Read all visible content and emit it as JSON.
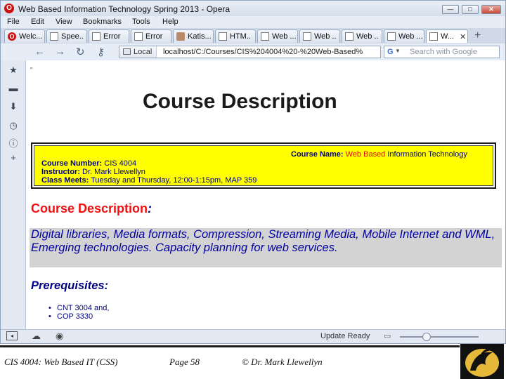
{
  "browser": {
    "title": "Web Based Information Technology Spring 2013 - Opera",
    "window_buttons": {
      "min": "—",
      "max": "□",
      "close": "✕"
    },
    "menu": [
      "File",
      "Edit",
      "View",
      "Bookmarks",
      "Tools",
      "Help"
    ],
    "tabs": [
      {
        "label": "Welc...",
        "icon": "opera"
      },
      {
        "label": "Speе..",
        "icon": "page"
      },
      {
        "label": "Error",
        "icon": "page"
      },
      {
        "label": "Error",
        "icon": "page"
      },
      {
        "label": "Katis...",
        "icon": "avatar"
      },
      {
        "label": "HTM..",
        "icon": "page"
      },
      {
        "label": "Web ...",
        "icon": "page"
      },
      {
        "label": "Web ..",
        "icon": "page"
      },
      {
        "label": "Web ..",
        "icon": "page"
      },
      {
        "label": "Web ...",
        "icon": "page"
      },
      {
        "label": "W...",
        "icon": "page",
        "active": true
      }
    ],
    "new_tab": "+",
    "nav": {
      "back": "←",
      "forward": "→",
      "reload": "↻",
      "key": "⚷"
    },
    "address_badge": "Local",
    "url": "localhost/C:/Courses/CIS%204004%20-%20Web-Based%",
    "search_engine_icon": "G",
    "search_caret": "▼",
    "search_placeholder": "Search with Google",
    "side_icons": [
      "bookmarks-star-icon",
      "notes-icon",
      "downloads-icon",
      "history-clock-icon",
      "info-icon",
      "add-panel-icon"
    ],
    "status_text": "Update Ready",
    "status_icons": [
      "panel-toggle-icon",
      "cloud-icon",
      "turbo-icon"
    ]
  },
  "page": {
    "top_mark": "\"",
    "heading": "Course Description",
    "info": {
      "course_number_label": "Course Number:",
      "course_number": " CIS 4004",
      "instructor_label": "Instructor:",
      "instructor": " Dr. Mark Llewellyn",
      "meets_label": "Class Meets:",
      "meets": " Tuesday and Thursday, 12:00-1:15pm, MAP 359",
      "course_name_label": "Course Name:",
      "course_name_part1": " Web Based",
      "course_name_part2": " Information Technology"
    },
    "desc_heading": "Course Description",
    "desc_colon": ":",
    "desc_text": "Digital libraries, Media formats, Compression, Streaming Media, Mobile Internet and WML, Emerging technologies. Capacity planning for web services.",
    "prereq_heading": "Prerequisites:",
    "prereqs": [
      "CNT 3004 and,",
      "COP 3330"
    ]
  },
  "footer": {
    "course": "CIS 4004: Web Based IT (CSS)",
    "page": "Page 58",
    "author": "© Dr. Mark Llewellyn"
  },
  "colors": {
    "info_bg": "#ffff00",
    "desc_red": "#ee1111",
    "navy": "#000080",
    "desc_bg": "#d3d3d3"
  }
}
